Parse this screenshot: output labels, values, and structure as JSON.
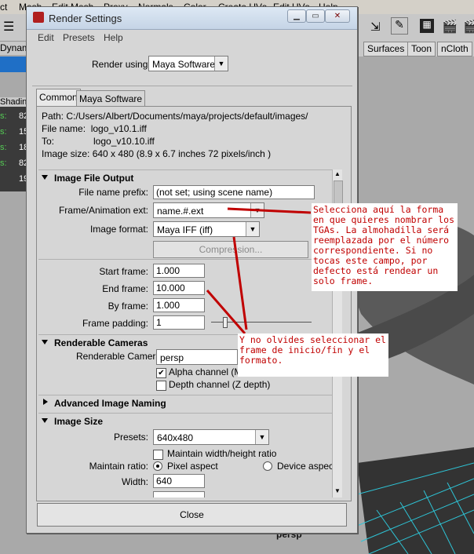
{
  "background": {
    "menu_items": [
      "ct",
      "Mesh",
      "Edit Mesh",
      "Proxy",
      "Normals",
      "Color",
      "Create UVs",
      "Edit UVs",
      "Help"
    ],
    "shelf_tabs": [
      "Surfaces",
      "Toon",
      "nCloth"
    ],
    "left_labels": [
      "Dynam",
      "Shadin"
    ],
    "side_values": [
      "82",
      "15",
      "18",
      "82",
      "19",
      "88"
    ],
    "side_prefix": [
      "s:",
      "s:",
      "s:",
      "s:"
    ],
    "viewport_label": "persp",
    "colors": {
      "accent": "#c00000",
      "wireframe": "#2ec4d6"
    }
  },
  "dialog": {
    "title": "Render Settings",
    "window_buttons": [
      "minimize",
      "maximize",
      "close"
    ],
    "menu": [
      "Edit",
      "Presets",
      "Help"
    ],
    "render_using_label": "Render using:",
    "render_using_value": "Maya Software",
    "tabs": [
      "Common",
      "Maya Software"
    ],
    "active_tab": "Common",
    "path_label": "Path:",
    "path_value": "C:/Users/Albert/Documents/maya/projects/default/images/",
    "file_name_label": "File name:",
    "file_name_value": "logo_v10.1.iff",
    "to_label": "To:",
    "to_value": "logo_v10.10.iff",
    "image_size_label": "Image size:",
    "image_size_value": "640 x 480 (8.9 x 6.7 inches 72 pixels/inch )",
    "sections": {
      "image_file_output": {
        "title": "Image File Output",
        "file_name_prefix_label": "File name prefix:",
        "file_name_prefix_value": "(not set; using scene name)",
        "frame_ext_label": "Frame/Animation ext:",
        "frame_ext_value": "name.#.ext",
        "image_format_label": "Image format:",
        "image_format_value": "Maya IFF (iff)",
        "compression_label": "Compression...",
        "start_frame_label": "Start frame:",
        "start_frame_value": "1.000",
        "end_frame_label": "End frame:",
        "end_frame_value": "10.000",
        "by_frame_label": "By frame:",
        "by_frame_value": "1.000",
        "frame_padding_label": "Frame padding:",
        "frame_padding_value": "1"
      },
      "renderable_cameras": {
        "title": "Renderable Cameras",
        "camera_label": "Renderable Camera",
        "camera_value": "persp",
        "alpha_label": "Alpha channel (Ma",
        "alpha_checked": true,
        "depth_label": "Depth channel (Z depth)",
        "depth_checked": false
      },
      "advanced_naming": {
        "title": "Advanced Image Naming"
      },
      "image_size": {
        "title": "Image Size",
        "presets_label": "Presets:",
        "presets_value": "640x480",
        "maintain_wh_label": "Maintain width/height ratio",
        "maintain_ratio_label": "Maintain ratio:",
        "pixel_aspect_label": "Pixel aspect",
        "device_aspect_label": "Device aspect",
        "width_label": "Width:",
        "width_value": "640"
      }
    },
    "close_label": "Close"
  },
  "annotations": {
    "note1": "Selecciona aquí la forma en que quieres nombrar los TGAs. La almohadilla será reemplazada por el número correspondiente. Si no tocas este campo, por defecto está rendear un solo frame.",
    "note2": "Y no olvides seleccionar el frame de inicio/fin y el formato."
  }
}
